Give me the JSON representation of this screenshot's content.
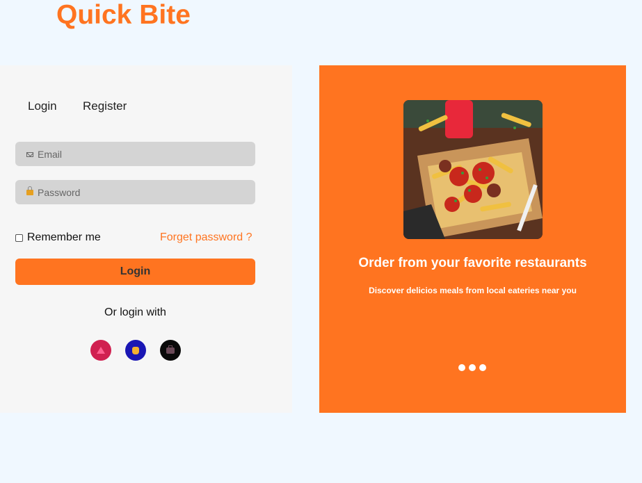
{
  "brand": {
    "name": "Quick Bite",
    "color": "#ff7420"
  },
  "auth_tabs": [
    {
      "label": "Login"
    },
    {
      "label": "Register"
    }
  ],
  "form": {
    "email": {
      "icon": "mail-icon",
      "placeholder": "Email",
      "value": ""
    },
    "password": {
      "icon": "lock-icon",
      "placeholder": "Password",
      "value": ""
    },
    "remember_label": "Remember me",
    "remember_checked": false,
    "forget_label": "Forget password ?",
    "submit_label": "Login",
    "or_login_with": "Or login with"
  },
  "social_buttons": [
    {
      "icon": "social-app-icon-1",
      "color": "#d02050"
    },
    {
      "icon": "thumbs-up-icon",
      "color": "#1a16b4"
    },
    {
      "icon": "briefcase-icon",
      "color": "#0a0a0a"
    }
  ],
  "promo": {
    "background": "#ff7420",
    "image": "food-photo",
    "title": "Order from your favorite restaurants",
    "subtitle": "Discover delicios meals from local eateries near you",
    "carousel_dots": 3
  }
}
